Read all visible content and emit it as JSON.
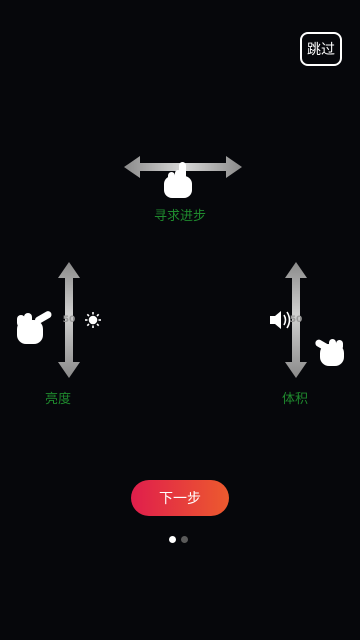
{
  "skip_label": "跳过",
  "gestures": {
    "seek": {
      "label": "寻求进步"
    },
    "brightness": {
      "label": "亮度",
      "value": "50"
    },
    "volume": {
      "label": "体积",
      "value": "50"
    }
  },
  "next_label": "下一步",
  "pagination": {
    "total": 2,
    "current": 1
  },
  "icons": {
    "brightness": "sun-icon",
    "volume": "speaker-icon",
    "hand": "pointing-hand-icon"
  },
  "colors": {
    "background": "#06070b",
    "label": "#1f8a2e",
    "accent_start": "#e01e4c",
    "accent_end": "#ec5a2e"
  }
}
